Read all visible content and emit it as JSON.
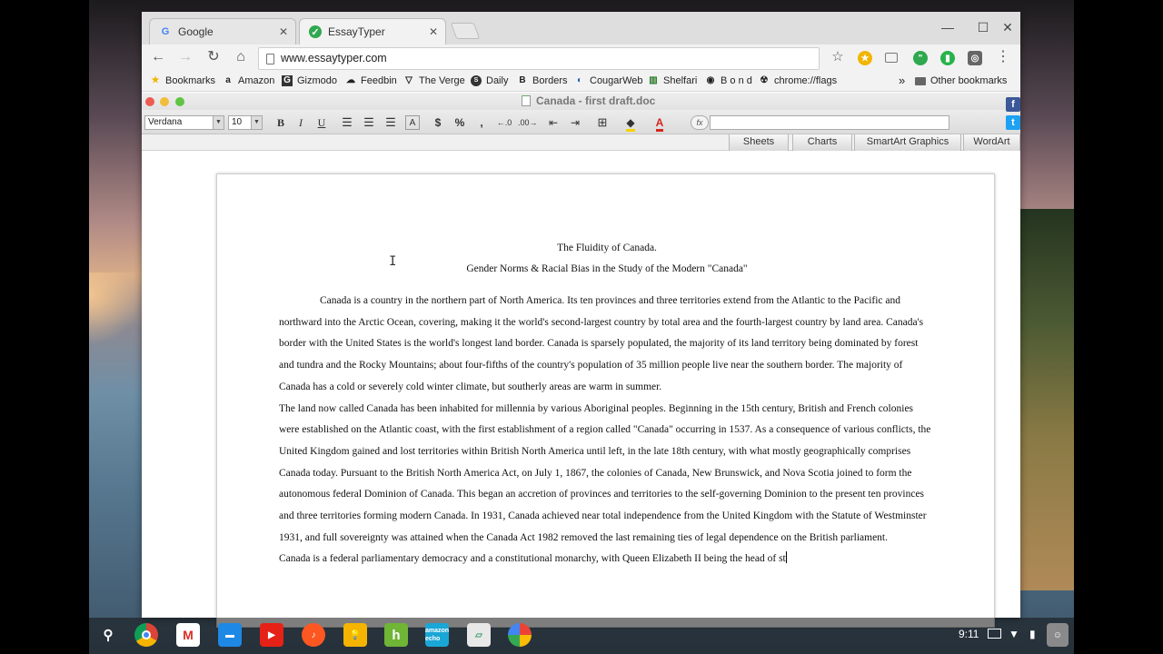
{
  "browser": {
    "tabs": [
      {
        "title": "Google",
        "favicon": "google-g-icon",
        "active": false
      },
      {
        "title": "EssayTyper",
        "favicon": "essaytyper-check-icon",
        "active": true
      }
    ],
    "url": "www.essaytyper.com",
    "bookmarks": [
      {
        "label": "Bookmarks",
        "icon": "star-icon"
      },
      {
        "label": "Amazon",
        "icon": "amazon-icon"
      },
      {
        "label": "Gizmodo",
        "icon": "gizmodo-icon"
      },
      {
        "label": "Feedbin",
        "icon": "feedbin-icon"
      },
      {
        "label": "The Verge",
        "icon": "verge-icon"
      },
      {
        "label": "Daily",
        "icon": "daily-icon"
      },
      {
        "label": "Borders",
        "icon": "borders-icon"
      },
      {
        "label": "CougarWeb",
        "icon": "cougarweb-icon"
      },
      {
        "label": "Shelfari",
        "icon": "shelfari-icon"
      },
      {
        "label": "B o n d",
        "icon": "bond-icon"
      },
      {
        "label": "chrome://flags",
        "icon": "flags-icon"
      }
    ],
    "other_bookmarks": "Other bookmarks",
    "overflow": "»"
  },
  "document": {
    "filename": "Canada - first draft.doc",
    "font": "Verdana",
    "font_size": "10",
    "format_buttons": {
      "bold": "B",
      "italic": "I",
      "underline": "U",
      "currency": "$",
      "percent": "%",
      "comma": ","
    },
    "fx_label": "fx",
    "ribbon_tabs": [
      "Sheets",
      "Charts",
      "SmartArt Graphics",
      "WordArt"
    ],
    "title": "The Fluidity of Canada.",
    "subtitle": "Gender Norms & Racial Bias in the Study of the Modern \"Canada\"",
    "paragraphs": [
      "Canada  is a country in the northern part of North America. Its ten provinces and three territories extend from the Atlantic to the Pacific and northward into the Arctic Ocean, covering, making it the world's second-largest country by total area and the fourth-largest country by land area. Canada's border with the United States is the world's longest land border. Canada is sparsely populated, the majority of its land territory being dominated by forest and tundra and the Rocky Mountains; about four-fifths of the country's population of 35 million people live near the southern border. The majority of Canada has a cold or severely cold winter climate, but southerly areas are warm in summer.",
      "The land now called Canada has been inhabited for millennia by various Aboriginal peoples. Beginning in the 15th century, British and French colonies were established on the Atlantic coast, with the first establishment of a region called \"Canada\" occurring in 1537. As a consequence of various conflicts, the United Kingdom gained and lost territories within British North America until left, in the late 18th century, with what mostly geographically comprises Canada today. Pursuant to the British North America Act, on July 1, 1867, the colonies of Canada, New Brunswick, and Nova Scotia joined to form the autonomous federal Dominion of Canada. This began an accretion of provinces and territories to the self-governing Dominion to the present ten provinces and three territories forming modern Canada. In 1931, Canada achieved near total independence from the United Kingdom with the Statute of Westminster 1931, and full sovereignty was attained when the Canada Act 1982 removed the last remaining ties of legal dependence on the British parliament.",
      "Canada is a federal parliamentary democracy and a constitutional monarchy, with Queen Elizabeth II being the head of st"
    ]
  },
  "shelf": {
    "apps": [
      "search-icon",
      "chrome-icon",
      "gmail-icon",
      "files-icon",
      "youtube-icon",
      "music-icon",
      "keep-icon",
      "houzz-icon",
      "amazon-echo-icon",
      "drawing-icon",
      "photos-icon"
    ],
    "echo_label": "amazon echo",
    "time": "9:11"
  },
  "colors": {
    "accent_tab_green": "#2fa84f",
    "text_color_red": "#d6261e",
    "highlight_yellow": "#f4d300",
    "facebook_blue": "#3b5998",
    "twitter_blue": "#1da1f2"
  }
}
